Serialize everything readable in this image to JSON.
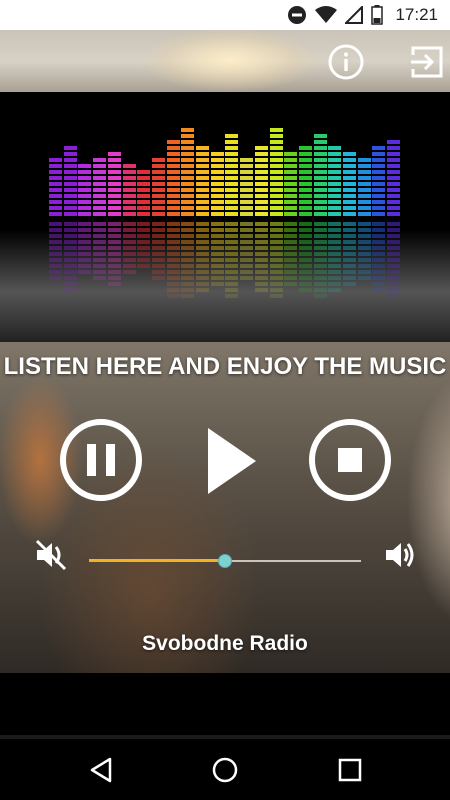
{
  "status_bar": {
    "time": "17:21",
    "icons": [
      "do-not-disturb-icon",
      "wifi-icon",
      "signal-icon",
      "battery-icon"
    ]
  },
  "toolbar": {
    "info_icon": "info-icon",
    "exit_icon": "exit-icon"
  },
  "main": {
    "headline": "LISTEN HERE AND ENJOY THE MUSIC",
    "controls": [
      "pause-icon",
      "play-icon",
      "stop-icon"
    ],
    "volume": {
      "mute_icon": "volume-mute-icon",
      "max_icon": "volume-up-icon",
      "level_fraction": 0.5
    },
    "station_name": "Svobodne Radio"
  },
  "colors": {
    "accent_fill": "#f0b323",
    "thumb": "#7fd1cf"
  },
  "nav_bar": {
    "icons": [
      "back-icon",
      "home-icon",
      "recent-apps-icon"
    ]
  }
}
